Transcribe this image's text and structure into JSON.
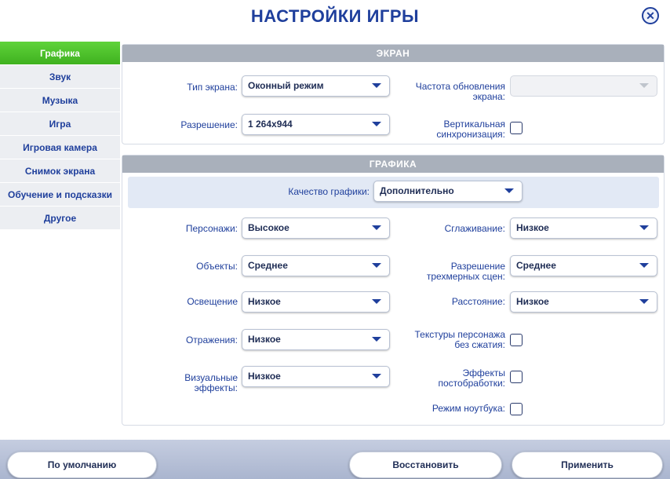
{
  "title": "НАСТРОЙКИ ИГРЫ",
  "close_icon": "close-icon",
  "sidebar": {
    "items": [
      {
        "label": "Графика",
        "active": true
      },
      {
        "label": "Звук"
      },
      {
        "label": "Музыка"
      },
      {
        "label": "Игра"
      },
      {
        "label": "Игровая камера"
      },
      {
        "label": "Снимок экрана"
      },
      {
        "label": "Обучение и подсказки"
      },
      {
        "label": "Другое"
      }
    ]
  },
  "screen": {
    "header": "ЭКРАН",
    "display_type": {
      "label": "Тип экрана:",
      "value": "Оконный режим"
    },
    "refresh_rate": {
      "label_line1": "Частота обновления",
      "label_line2": "экрана:",
      "value": ""
    },
    "resolution": {
      "label": "Разрешение:",
      "value": "1 264x944"
    },
    "vsync": {
      "label_line1": "Вертикальная",
      "label_line2": "синхронизация:",
      "checked": false
    }
  },
  "graphics": {
    "header": "ГРАФИКА",
    "quality": {
      "label": "Качество графики:",
      "value": "Дополнительно"
    },
    "sims": {
      "label": "Персонажи:",
      "value": "Высокое"
    },
    "antialias": {
      "label": "Сглаживание:",
      "value": "Низкое"
    },
    "objects": {
      "label": "Объекты:",
      "value": "Среднее"
    },
    "scene_resolution": {
      "label_line1": "Разрешение",
      "label_line2": "трехмерных сцен:",
      "value": "Среднее"
    },
    "lighting": {
      "label": "Освещение",
      "value": "Низкое"
    },
    "distance": {
      "label": "Расстояние:",
      "value": "Низкое"
    },
    "reflections": {
      "label": "Отражения:",
      "value": "Низкое"
    },
    "uncompressed_textures": {
      "label_line1": "Текстуры персонажа",
      "label_line2": "без сжатия:",
      "checked": false
    },
    "visual_effects": {
      "label_line1": "Визуальные",
      "label_line2": "эффекты:",
      "value": "Низкое"
    },
    "post_processing": {
      "label_line1": "Эффекты",
      "label_line2": "постобработки:",
      "checked": false
    },
    "laptop_mode": {
      "label": "Режим ноутбука:",
      "checked": false
    }
  },
  "buttons": {
    "defaults": "По умолчанию",
    "restore": "Восстановить",
    "apply": "Применить"
  },
  "colors": {
    "accent_blue": "#1f3f9c",
    "active_tab_green": "#4cc22a",
    "panel_header_gray": "#a9b0bb"
  }
}
